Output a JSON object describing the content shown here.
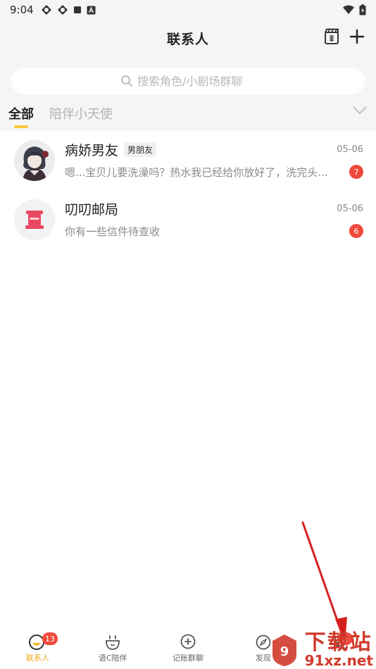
{
  "status_bar": {
    "time": "9:04"
  },
  "header": {
    "title": "联系人"
  },
  "search": {
    "placeholder": "搜索角色/小剧场群聊"
  },
  "tabs": [
    {
      "label": "全部",
      "active": true
    },
    {
      "label": "陪伴小天使",
      "active": false
    }
  ],
  "contacts": [
    {
      "name": "病娇男友",
      "tag": "男朋友",
      "date": "05-06",
      "preview": "嗯...宝贝儿要洗澡吗？热水我已经给你放好了，洗完头...",
      "unread": "7"
    },
    {
      "name": "叨叨邮局",
      "tag": "",
      "date": "05-06",
      "preview": "你有一些信件待查收",
      "unread": "6"
    }
  ],
  "bottom_nav": [
    {
      "label": "联系人",
      "badge": "13",
      "icon": "contacts-icon",
      "active": true
    },
    {
      "label": "语C陪伴",
      "badge": "",
      "icon": "companion-icon",
      "active": false
    },
    {
      "label": "记账群聊",
      "badge": "",
      "icon": "group-chat-icon",
      "active": false
    },
    {
      "label": "发现",
      "badge": "",
      "icon": "discover-icon",
      "active": false
    },
    {
      "label": "",
      "badge": "2",
      "icon": "profile-icon",
      "active": false
    }
  ],
  "watermark": {
    "big_text": "下载站",
    "small_text": "91xz.net"
  },
  "colors": {
    "accent": "#f0a81e",
    "badge": "#f04a3c",
    "tab_underline": "#ffc93c",
    "arrow": "#d42020"
  }
}
